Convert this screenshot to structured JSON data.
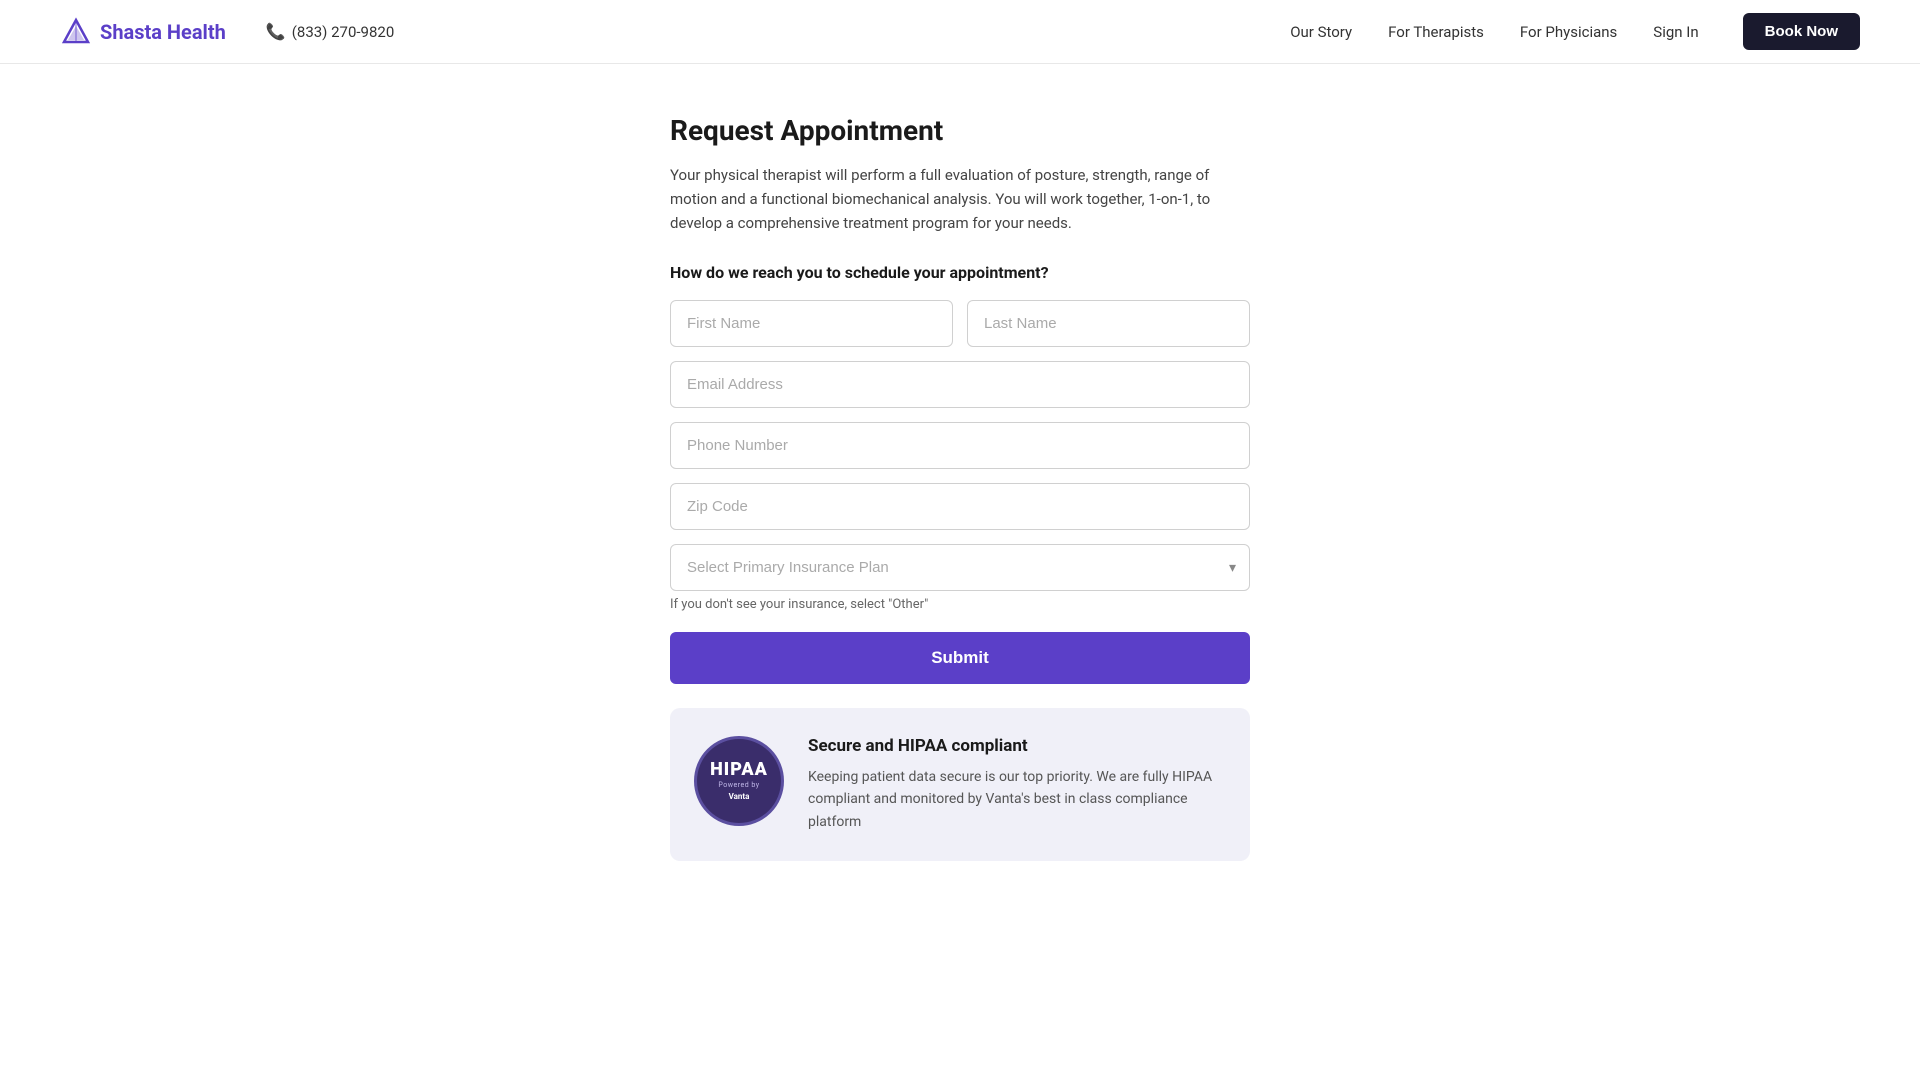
{
  "nav": {
    "logo_text": "Shasta Health",
    "phone": "(833) 270-9820",
    "links": [
      {
        "label": "Our Story",
        "id": "our-story"
      },
      {
        "label": "For Therapists",
        "id": "for-therapists"
      },
      {
        "label": "For Physicians",
        "id": "for-physicians"
      },
      {
        "label": "Sign In",
        "id": "sign-in"
      }
    ],
    "book_btn": "Book Now"
  },
  "main": {
    "title": "Request Appointment",
    "description": "Your physical therapist will perform a full evaluation of posture, strength, range of motion and a functional biomechanical analysis. You will work together, 1-on-1, to develop a comprehensive treatment program for your needs.",
    "form_question": "How do we reach you to schedule your appointment?",
    "fields": {
      "first_name_placeholder": "First Name",
      "last_name_placeholder": "Last Name",
      "email_placeholder": "Email Address",
      "phone_placeholder": "Phone Number",
      "zip_placeholder": "Zip Code",
      "insurance_placeholder": "Select Primary Insurance Plan",
      "insurance_hint": "If you don't see your insurance, select \"Other\""
    },
    "submit_btn": "Submit",
    "hipaa": {
      "badge_title": "HIPAA",
      "badge_powered": "Powered by",
      "badge_brand": "Vanta",
      "title": "Secure and HIPAA compliant",
      "description": "Keeping patient data secure is our top priority. We are fully HIPAA compliant and monitored by Vanta's best in class compliance platform"
    }
  }
}
